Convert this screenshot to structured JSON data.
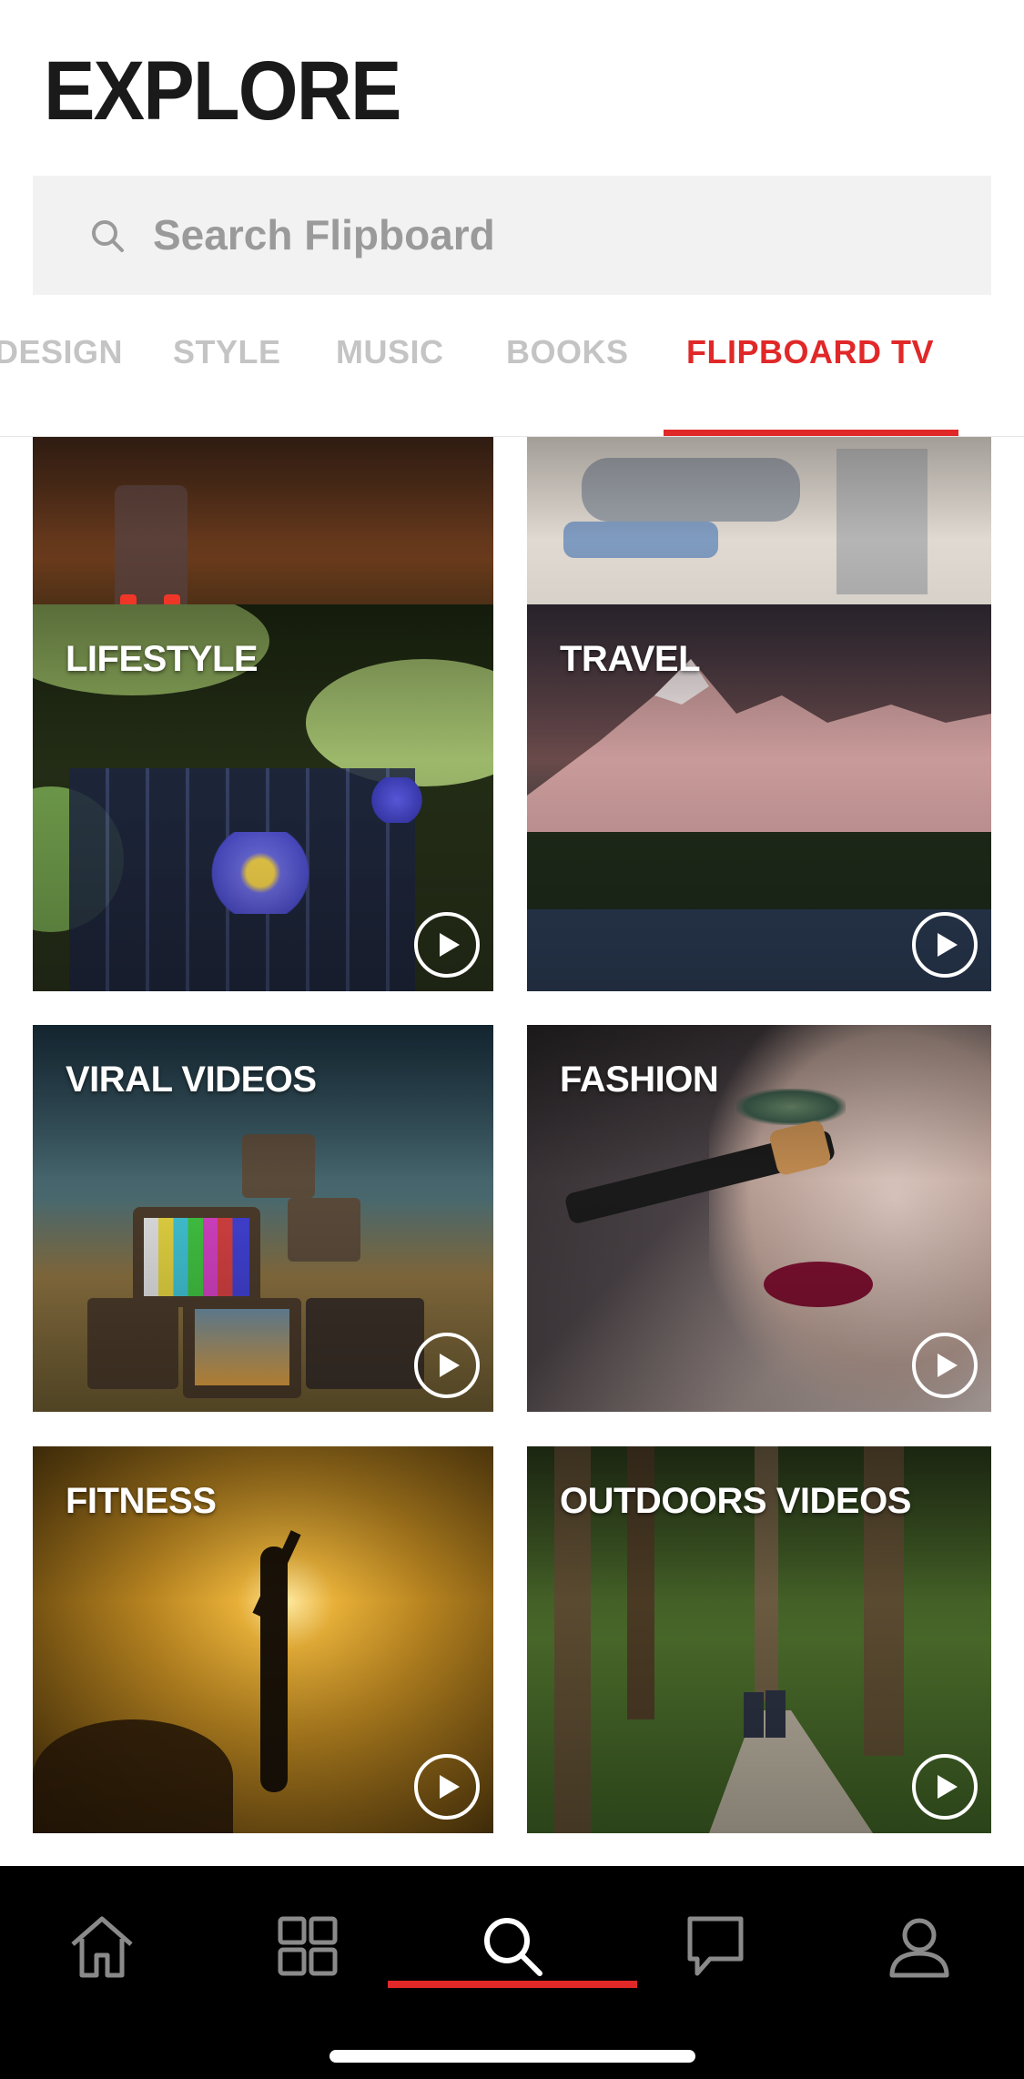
{
  "header": {
    "title": "EXPLORE"
  },
  "search": {
    "placeholder": "Search Flipboard",
    "value": ""
  },
  "tabs": [
    {
      "label": "DESIGN",
      "active": false
    },
    {
      "label": "STYLE",
      "active": false
    },
    {
      "label": "MUSIC",
      "active": false
    },
    {
      "label": "BOOKS",
      "active": false
    },
    {
      "label": "FLIPBOARD TV",
      "active": true
    }
  ],
  "tiles": [
    {
      "label": "",
      "icon": "play-icon"
    },
    {
      "label": "",
      "icon": "play-icon"
    },
    {
      "label": "LIFESTYLE",
      "icon": "play-icon"
    },
    {
      "label": "TRAVEL",
      "icon": "play-icon"
    },
    {
      "label": "VIRAL VIDEOS",
      "icon": "play-icon"
    },
    {
      "label": "FASHION",
      "icon": "play-icon"
    },
    {
      "label": "FITNESS",
      "icon": "play-icon"
    },
    {
      "label": "OUTDOORS VIDEOS",
      "icon": "play-icon"
    }
  ],
  "nav": {
    "items": [
      "home-icon",
      "grid-icon",
      "search-icon",
      "chat-icon",
      "profile-icon"
    ],
    "active": "search-icon"
  },
  "colors": {
    "accent": "#e12828",
    "nav_bg": "#000000",
    "search_bg": "#f2f2f2"
  }
}
